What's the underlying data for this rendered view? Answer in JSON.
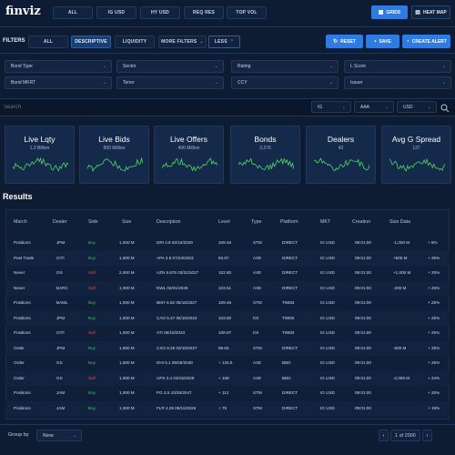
{
  "brand": "finviz",
  "top_tabs": [
    {
      "label": "ALL",
      "active": false
    },
    {
      "label": "IG USD",
      "active": false
    },
    {
      "label": "HY USD",
      "active": false
    },
    {
      "label": "REQ RES",
      "active": false
    },
    {
      "label": "TOP VOL",
      "active": false
    }
  ],
  "view_buttons": {
    "grids": "GRIDS",
    "heat_map": "HEAT MAP"
  },
  "filters": {
    "label": "FILTERS",
    "tabs": [
      "ALL",
      "DESCRIPTIVE",
      "LIQUIDITY",
      "MORE FILTERS"
    ],
    "active_tab": "DESCRIPTIVE",
    "less": "LESS",
    "reset": "RESET",
    "save": "SAVE",
    "create_alert": "CREATE ALERT"
  },
  "dropdowns_row1": [
    "Bond Type",
    "Sector",
    "Rating",
    "L Score"
  ],
  "dropdowns_row2": [
    "Bond MKRT",
    "Tenor",
    "CCY",
    "Issuer"
  ],
  "search": {
    "placeholder": "Search",
    "ig": "IG",
    "rating": "AAA",
    "ccy": "USD"
  },
  "cards": [
    {
      "title": "Live Lqty",
      "sub": "1.2 Billion"
    },
    {
      "title": "Live Bids",
      "sub": "800 Million"
    },
    {
      "title": "Live Offers",
      "sub": "400 Million"
    },
    {
      "title": "Bonds",
      "sub": "3,276"
    },
    {
      "title": "Dealers",
      "sub": "42"
    },
    {
      "title": "Avg G Spread",
      "sub": "137"
    }
  ],
  "colors": {
    "accent": "#2f7be0",
    "buy": "#34c759",
    "sell": "#ff453a",
    "spark": "#4cd964"
  },
  "results_title": "Results",
  "columns": [
    "March",
    "Dealer",
    "Side",
    "Size",
    "Description",
    "Level",
    "Type",
    "Platform",
    "MKT",
    "Creation",
    "Size Data"
  ],
  "rows": [
    [
      "Positions",
      "JPM",
      "Buy",
      "1,000 M",
      "DRI 4.8 02/15/2029",
      "109.46",
      "STM",
      "DIRECT",
      "IG USD",
      "09:01:00",
      "-1,000 M",
      "+ 8%"
    ],
    [
      "Past Trade",
      "CITI",
      "Buy",
      "1,000 M",
      "APA 2.8 07/23/2023",
      "83.87",
      "AXE",
      "DIRECT",
      "IG USD",
      "09:01:00",
      "+500 M",
      "+ 25%"
    ],
    [
      "Never",
      "GS",
      "Sell",
      "2,000 M",
      "AZN 5.875 03/31/2027",
      "102.80",
      "AXE",
      "DIRECT",
      "IG USD",
      "09:01:00",
      "+1,000 M",
      "+ 25%"
    ],
    [
      "Never",
      "BARC",
      "Sell",
      "1,000 M",
      "NWL 04/01/2026",
      "103.51",
      "AXE",
      "DIRECT",
      "IG USD",
      "09:01:00",
      "-200 M",
      "+ 25%"
    ],
    [
      "Positions",
      "BAML",
      "Buy",
      "1,000 M",
      "BMY 6.62 05/15/2027",
      "109.46",
      "STM",
      "TWEB",
      "IG USD",
      "09:01:00",
      "",
      "+ 25%"
    ],
    [
      "Positions",
      "JPM",
      "Buy",
      "1,000 M",
      "CAO 5.37 05/15/2024",
      "103.50",
      "IOI",
      "TWEB",
      "IG USD",
      "09:01:00",
      "",
      "+ 25%"
    ],
    [
      "Positions",
      "CITI",
      "Sell",
      "1,000 M",
      "ATI 06/15/2023",
      "108.97",
      "IOI",
      "TWEB",
      "IG USD",
      "09:01:00",
      "",
      "+ 25%"
    ],
    [
      "Order",
      "JPM",
      "Buy",
      "1,000 M",
      "CXO 8.25 02/15/2027",
      "98.84",
      "STM",
      "DIRECT",
      "IG USD",
      "09:01:00",
      "-500 M",
      "+ 25%"
    ],
    [
      "Order",
      "GS",
      "Buy",
      "1,000 M",
      "DHI 5.1 09/28/2048",
      "+ 134.5",
      "AXE",
      "BBG",
      "IG USD",
      "09:01:00",
      "",
      "+ 25%"
    ],
    [
      "Order",
      "GS",
      "Sell",
      "1,000 M",
      "UPS 3.4 03/15/2029",
      "+ 158",
      "AXE",
      "BBG",
      "IG USD",
      "09:01:00",
      "-2,000 M",
      "+ 24%"
    ],
    [
      "Positions",
      "JAM",
      "Buy",
      "1,000 M",
      "PG 3.5 10/25/2047",
      "+ 112",
      "STM",
      "DIRECT",
      "IG USD",
      "09:01:00",
      "",
      "+ 25%"
    ],
    [
      "Positions",
      "JAM",
      "Buy",
      "1,000 M",
      "FLR 4.25 09/15/2028",
      "+ 75",
      "STM",
      "DIRECT",
      "IG USD",
      "09:01:00",
      "",
      "+ 19%"
    ]
  ],
  "footer": {
    "group_by": "Group by",
    "group_value": "None",
    "page": "1 of 2000"
  }
}
